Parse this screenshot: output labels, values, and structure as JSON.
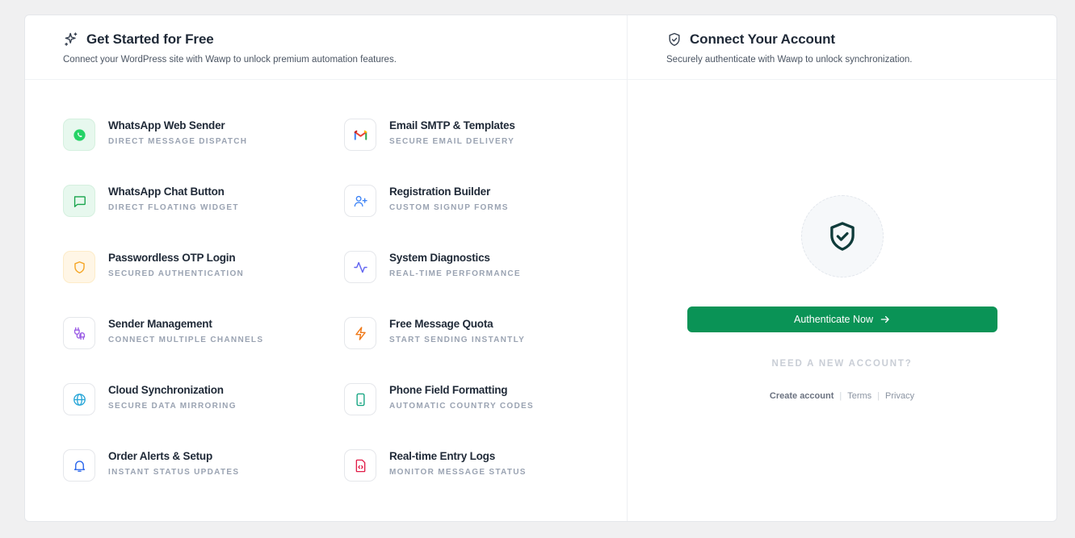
{
  "left": {
    "title": "Get Started for Free",
    "subtitle": "Connect your WordPress site with Wawp to unlock premium automation features.",
    "features": [
      {
        "title": "WhatsApp Web Sender",
        "subtitle": "DIRECT MESSAGE DISPATCH",
        "icon": "whatsapp-icon"
      },
      {
        "title": "Email SMTP & Templates",
        "subtitle": "SECURE EMAIL DELIVERY",
        "icon": "gmail-icon"
      },
      {
        "title": "WhatsApp Chat Button",
        "subtitle": "DIRECT FLOATING WIDGET",
        "icon": "chat-bubble-icon"
      },
      {
        "title": "Registration Builder",
        "subtitle": "CUSTOM SIGNUP FORMS",
        "icon": "user-plus-icon"
      },
      {
        "title": "Passwordless OTP Login",
        "subtitle": "SECURED AUTHENTICATION",
        "icon": "shield-icon"
      },
      {
        "title": "System Diagnostics",
        "subtitle": "REAL-TIME PERFORMANCE",
        "icon": "activity-icon"
      },
      {
        "title": "Sender Management",
        "subtitle": "CONNECT MULTIPLE CHANNELS",
        "icon": "plug-icon"
      },
      {
        "title": "Free Message Quota",
        "subtitle": "START SENDING INSTANTLY",
        "icon": "lightning-icon"
      },
      {
        "title": "Cloud Synchronization",
        "subtitle": "SECURE DATA MIRRORING",
        "icon": "globe-icon"
      },
      {
        "title": "Phone Field Formatting",
        "subtitle": "AUTOMATIC COUNTRY CODES",
        "icon": "phone-icon"
      },
      {
        "title": "Order Alerts & Setup",
        "subtitle": "INSTANT STATUS UPDATES",
        "icon": "bell-icon"
      },
      {
        "title": "Real-time Entry Logs",
        "subtitle": "MONITOR MESSAGE STATUS",
        "icon": "code-file-icon"
      }
    ]
  },
  "right": {
    "title": "Connect Your Account",
    "subtitle": "Securely authenticate with Wawp to unlock synchronization.",
    "auth_button": "Authenticate Now",
    "need_account": "NEED A NEW ACCOUNT?",
    "links": {
      "create": "Create account",
      "terms": "Terms",
      "privacy": "Privacy",
      "separator": "|"
    }
  },
  "colors": {
    "primary_green": "#0a9356",
    "whatsapp_green": "#25d366",
    "otp_amber": "#f5a524",
    "plug_purple": "#9b5de5",
    "lightning_orange": "#f07a1a",
    "globe_blue": "#2aa7d8",
    "phone_green": "#10a37f",
    "bell_blue": "#2563eb",
    "code_red": "#e11d48"
  }
}
